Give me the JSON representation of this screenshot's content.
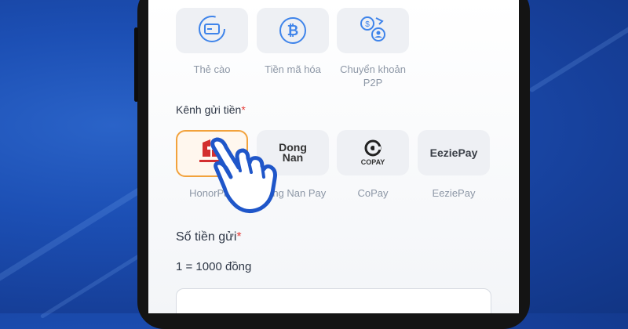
{
  "methods": [
    {
      "label": "Thẻ cào",
      "icon": "card-refresh-icon"
    },
    {
      "label": "Tiền mã hóa",
      "icon": "bitcoin-icon"
    },
    {
      "label": "Chuyển khoản P2P",
      "icon": "p2p-transfer-icon"
    }
  ],
  "channel_section": {
    "title": "Kênh gửi tiền",
    "required_mark": "*"
  },
  "channels": [
    {
      "label": "HonorPay",
      "logo": "HONOR PAY",
      "selected": true
    },
    {
      "label": "Dong Nan Pay",
      "logo": "Dong Nan",
      "selected": false
    },
    {
      "label": "CoPay",
      "logo": "COPAY",
      "selected": false
    },
    {
      "label": "EeziePay",
      "logo": "EeziePay",
      "selected": false
    }
  ],
  "amount_section": {
    "title": "Số tiền gửi",
    "required_mark": "*",
    "rate": "1 = 1000 đồng"
  },
  "colors": {
    "accent": "#3f84ea",
    "selected_border": "#f2a23c",
    "required": "#e53935",
    "background": "#1c4fb4"
  }
}
